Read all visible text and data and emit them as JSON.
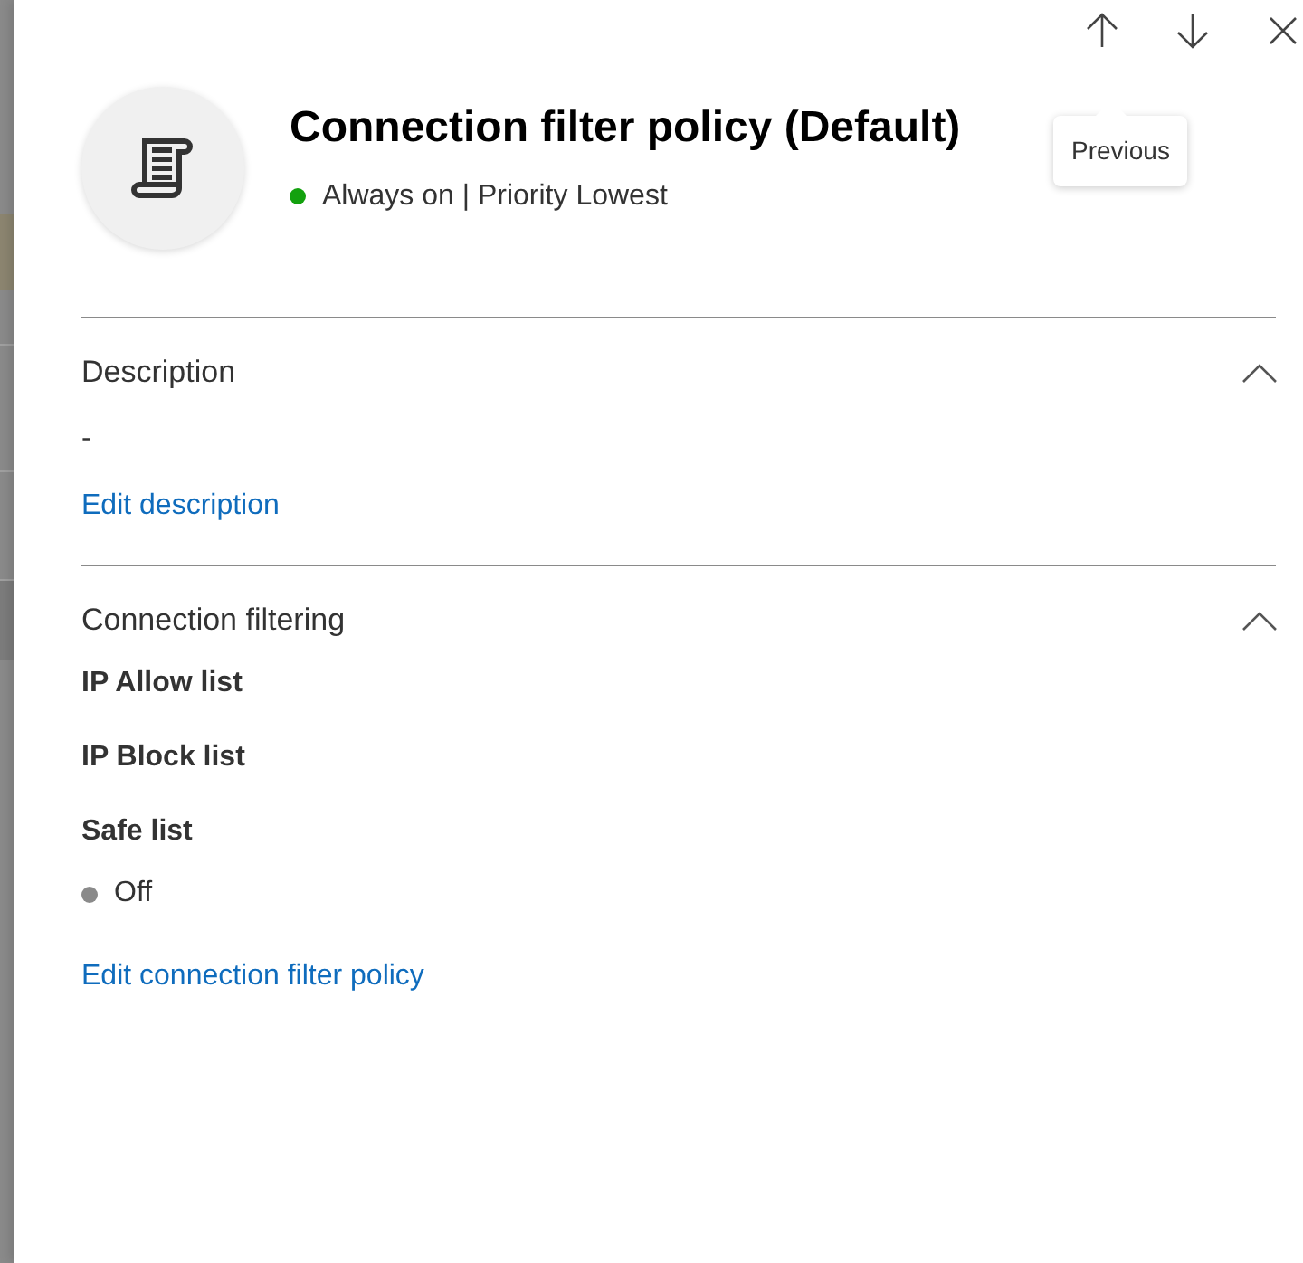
{
  "toolbar": {
    "buttons": [
      {
        "kind": "previous"
      },
      {
        "kind": "next"
      },
      {
        "kind": "close"
      }
    ],
    "tooltip": "Previous"
  },
  "header": {
    "title": "Connection filter policy (Default)",
    "status": {
      "text": "Always on | Priority Lowest",
      "color": "#13a10e"
    }
  },
  "sections": [
    {
      "title": "Description",
      "expanded": true,
      "fields": [
        {
          "kind": "text",
          "value": "-"
        }
      ],
      "link": "Edit description"
    },
    {
      "title": "Connection filtering",
      "expanded": true,
      "fields": [
        {
          "kind": "label",
          "label": "IP Allow list"
        },
        {
          "kind": "label",
          "label": "IP Block list"
        },
        {
          "kind": "status",
          "label": "Safe list",
          "status": {
            "text": "Off",
            "color": "#8a8a8a"
          }
        }
      ],
      "link": "Edit connection filter policy"
    }
  ]
}
